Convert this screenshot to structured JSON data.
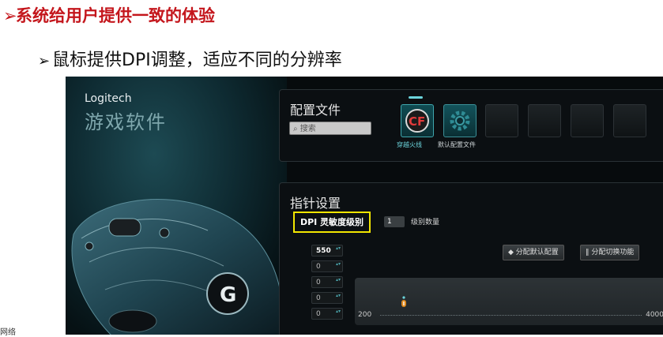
{
  "slide": {
    "bullet1": "系统给用户提供一致的体验",
    "bullet2": "鼠标提供DPI调整，适应不同的分辨率",
    "side_note": "网络"
  },
  "app": {
    "brand": "Logitech",
    "brand_cn": "游戏软件",
    "profiles": {
      "title": "配置文件",
      "search_placeholder": "搜索",
      "items": [
        {
          "label": "穿越火线",
          "icon": "crossfire-game-icon",
          "active": true
        },
        {
          "label": "默认配置文件",
          "icon": "gear-icon",
          "active": false
        }
      ],
      "empty_slots": 4
    },
    "pointer": {
      "title": "指针设置",
      "dpi_label": "DPI 灵敏度级别",
      "level_count": "1",
      "level_count_label": "级别数量",
      "btn_assign_default": "◆ 分配默认配置",
      "btn_assign_switch": "‖ 分配切换功能",
      "dpi_values": [
        "550",
        "0",
        "0",
        "0",
        "0"
      ],
      "slider_min": "200",
      "slider_max": "4000",
      "slider_value": 550
    }
  },
  "colors": {
    "title_red": "#c4161c",
    "highlight_yellow": "#f2e600",
    "accent_teal": "#4aa3aa",
    "handle_orange": "#e08a1e"
  }
}
